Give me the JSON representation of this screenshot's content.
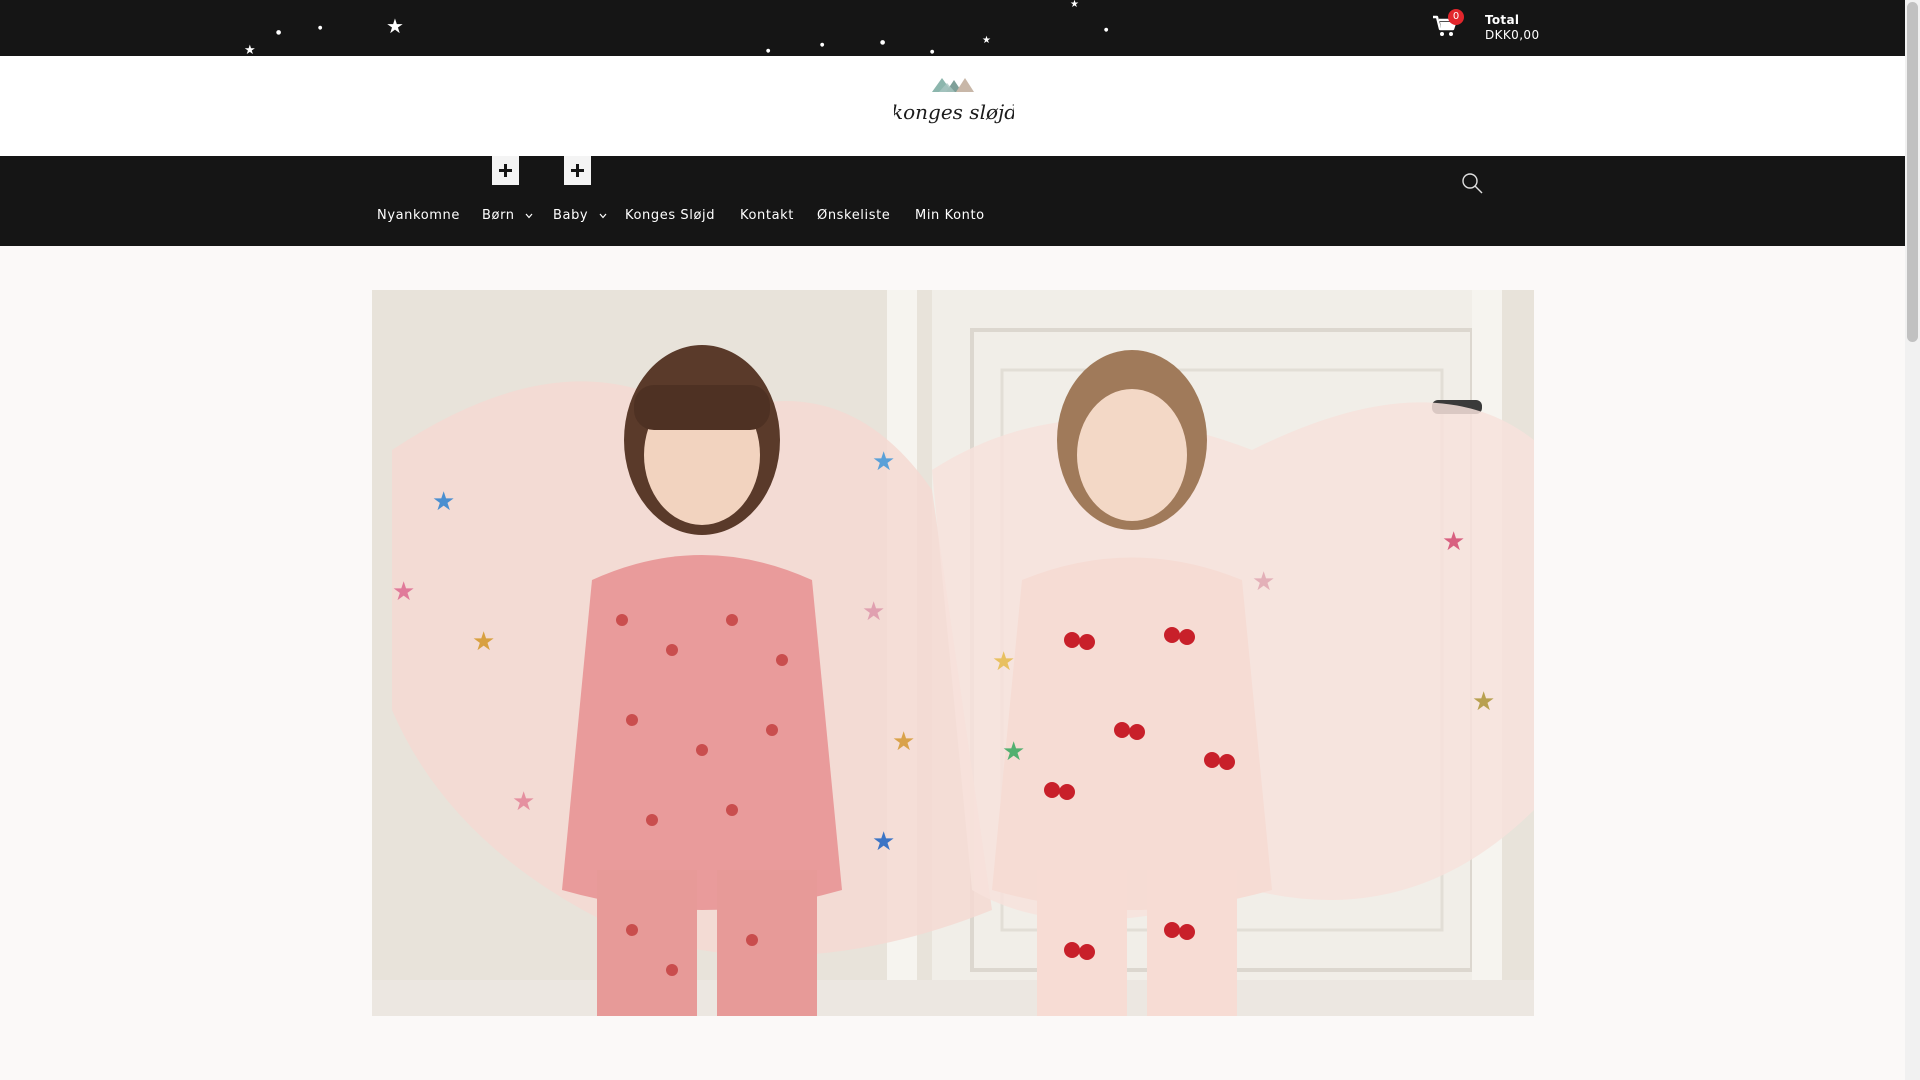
{
  "header": {
    "cart_count": "0",
    "total_label": "Total",
    "total_value": "DKK0,00"
  },
  "brand": {
    "logo_text": "konges sløjd"
  },
  "nav": {
    "items": [
      {
        "label": "Nyankomne",
        "has_submenu": false
      },
      {
        "label": "Børn",
        "has_submenu": true
      },
      {
        "label": "Baby",
        "has_submenu": true
      },
      {
        "label": "Konges Sløjd",
        "has_submenu": false
      },
      {
        "label": "Kontakt",
        "has_submenu": false
      },
      {
        "label": "Ønskeliste",
        "has_submenu": false
      },
      {
        "label": "Min Konto",
        "has_submenu": false
      }
    ]
  },
  "icons": {
    "cart": "cart-icon",
    "search": "search-icon",
    "expand": "plus-icon",
    "chevron": "chevron-down-icon"
  },
  "colors": {
    "topbar": "#151515",
    "badge": "#e2262c",
    "page_background": "#fbf9f8"
  }
}
